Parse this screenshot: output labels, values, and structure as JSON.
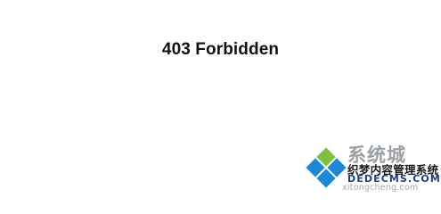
{
  "page": {
    "title": "403 Forbidden"
  },
  "watermark": {
    "brand_text": "系统城",
    "cn_text": "织梦内容管理系统",
    "dede_text": "DEDECMS.COM",
    "url_text": "xitongcheng.com",
    "logo_colors": {
      "blue": "#1e88d6",
      "green": "#7cc242"
    }
  }
}
